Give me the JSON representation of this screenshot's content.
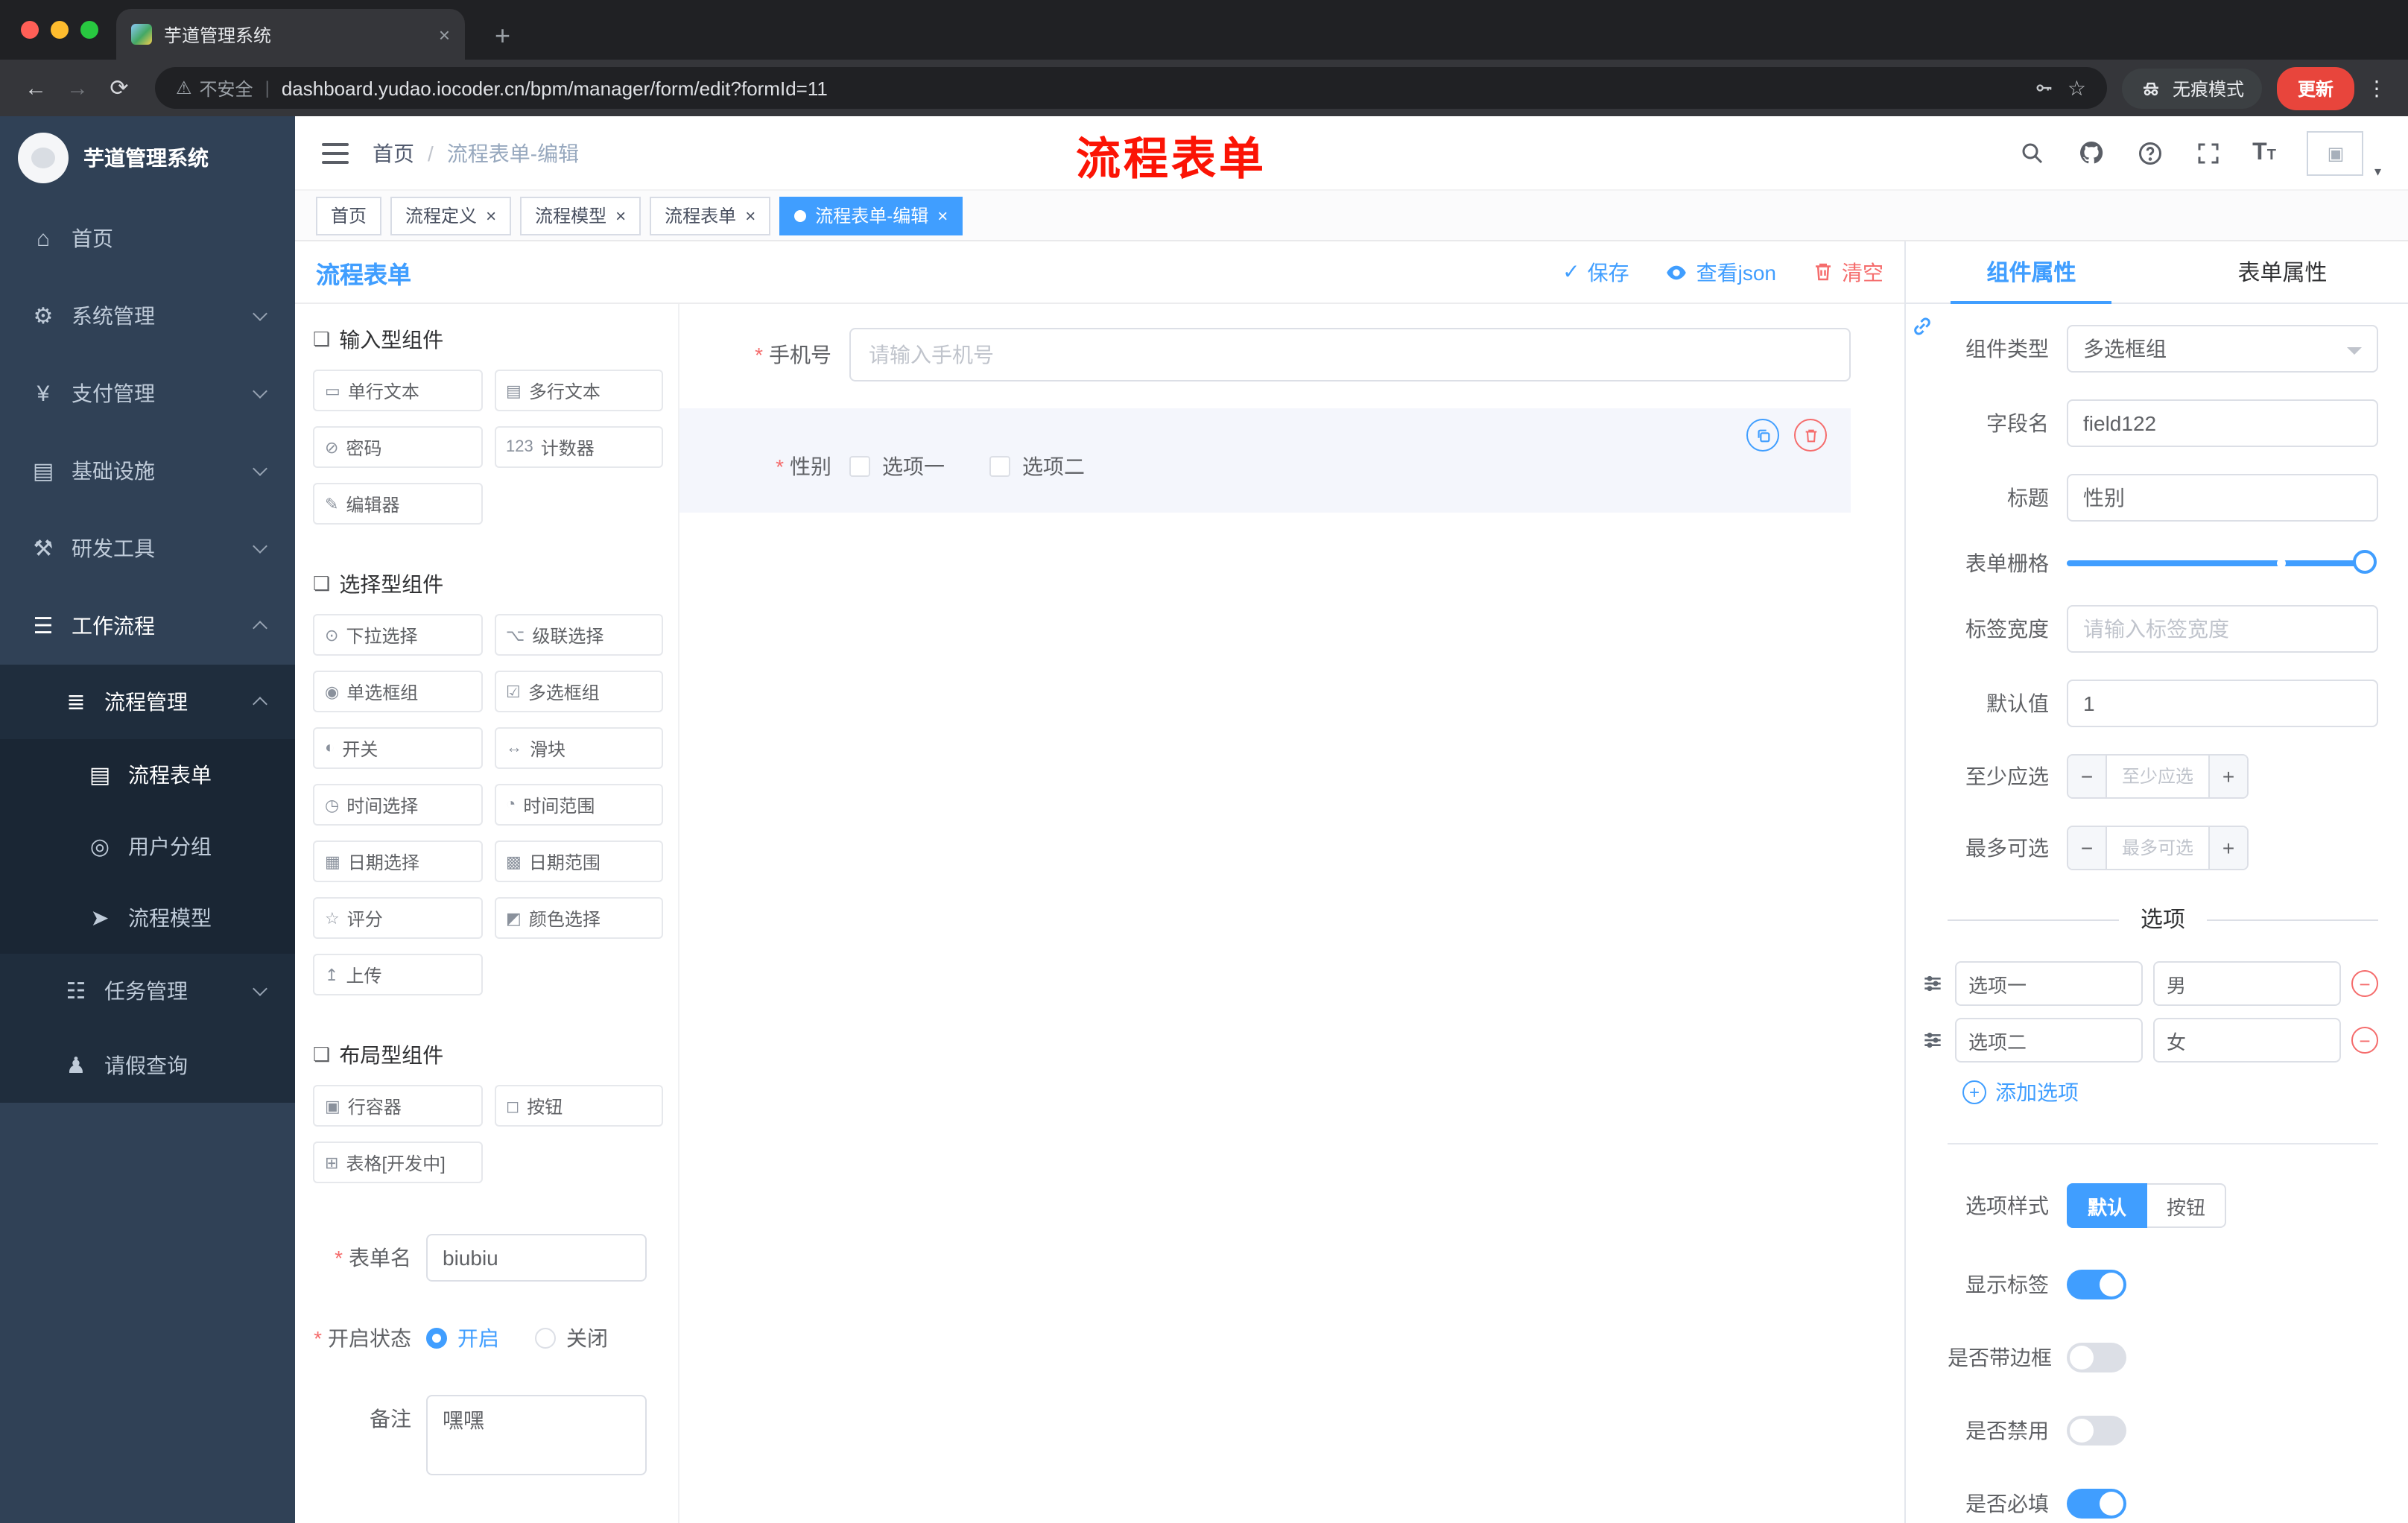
{
  "glyphs": {
    "back": "←",
    "forward": "→",
    "reload": "⟳",
    "plus": "+",
    "close": "×",
    "warning": "⚠",
    "star": "☆",
    "dots": "⋮",
    "caret_down": "▾",
    "pipe": "|",
    "check": "✓",
    "minus": "−",
    "sep": "/",
    "question": "?",
    "font_big": "T",
    "font_small": "T",
    "image_placeholder": "▣",
    "palette_group": "❏"
  },
  "colors": {
    "primary": "#409eff",
    "danger": "#f56c6c",
    "sidebar_bg": "#304156",
    "update_badge": "#e8453c",
    "annotation_red": "#fb1405"
  },
  "browser": {
    "tab_title": "芋道管理系统",
    "address": {
      "warning": "不安全",
      "url": "dashboard.yudao.iocoder.cn/bpm/manager/form/edit?formId=11"
    },
    "incognito_label": "无痕模式",
    "update_label": "更新"
  },
  "annotation": {
    "text": "流程表单"
  },
  "sidebar": {
    "brand": "芋道管理系统",
    "menu": {
      "home": {
        "label": "首页",
        "glyph": "⌂"
      },
      "system": {
        "label": "系统管理",
        "glyph": "⚙"
      },
      "pay": {
        "label": "支付管理",
        "glyph": "¥"
      },
      "infra": {
        "label": "基础设施",
        "glyph": "▤"
      },
      "dev": {
        "label": "研发工具",
        "glyph": "⚒"
      },
      "workflow": {
        "label": "工作流程",
        "glyph": "☰"
      },
      "process_mgmt": {
        "label": "流程管理",
        "glyph": "≣"
      },
      "process_form": {
        "label": "流程表单",
        "glyph": "▤"
      },
      "user_group": {
        "label": "用户分组",
        "glyph": "◎"
      },
      "process_model": {
        "label": "流程模型",
        "glyph": "➤"
      },
      "task_mgmt": {
        "label": "任务管理",
        "glyph": "☷"
      },
      "leave_query": {
        "label": "请假查询",
        "glyph": "♟"
      }
    }
  },
  "header": {
    "breadcrumb": {
      "home": "首页",
      "current": "流程表单-编辑"
    }
  },
  "tags": [
    {
      "label": "首页"
    },
    {
      "label": "流程定义",
      "closable": true
    },
    {
      "label": "流程模型",
      "closable": true
    },
    {
      "label": "流程表单",
      "closable": true
    },
    {
      "label": "流程表单-编辑",
      "closable": true,
      "active": true
    }
  ],
  "designer": {
    "title": "流程表单",
    "actions": {
      "save": "保存",
      "view_json": "查看json",
      "clear": "清空"
    }
  },
  "palette": {
    "groups": [
      {
        "title": "输入型组件",
        "items": [
          {
            "glyph": "▭",
            "label": "单行文本"
          },
          {
            "glyph": "▤",
            "label": "多行文本"
          },
          {
            "glyph": "⊘",
            "label": "密码"
          },
          {
            "glyph": "123",
            "label": "计数器"
          },
          {
            "glyph": "✎",
            "label": "编辑器"
          }
        ]
      },
      {
        "title": "选择型组件",
        "items": [
          {
            "glyph": "⊙",
            "label": "下拉选择"
          },
          {
            "glyph": "⌥",
            "label": "级联选择"
          },
          {
            "glyph": "◉",
            "label": "单选框组"
          },
          {
            "glyph": "☑",
            "label": "多选框组"
          },
          {
            "glyph": "◐",
            "label": "开关"
          },
          {
            "glyph": "↔",
            "label": "滑块"
          },
          {
            "glyph": "◷",
            "label": "时间选择"
          },
          {
            "glyph": "◔",
            "label": "时间范围"
          },
          {
            "glyph": "▦",
            "label": "日期选择"
          },
          {
            "glyph": "▩",
            "label": "日期范围"
          },
          {
            "glyph": "☆",
            "label": "评分"
          },
          {
            "glyph": "◩",
            "label": "颜色选择"
          },
          {
            "glyph": "↥",
            "label": "上传"
          }
        ]
      },
      {
        "title": "布局型组件",
        "items": [
          {
            "glyph": "▣",
            "label": "行容器"
          },
          {
            "glyph": "◻",
            "label": "按钮"
          },
          {
            "glyph": "⊞",
            "label": "表格[开发中]"
          }
        ]
      }
    ]
  },
  "form_settings": {
    "name": {
      "label": "表单名",
      "value": "biubiu"
    },
    "status": {
      "label": "开启状态",
      "on": "开启",
      "off": "关闭"
    },
    "remark": {
      "label": "备注",
      "value": "嘿嘿"
    }
  },
  "canvas": {
    "phone": {
      "label": "手机号",
      "placeholder": "请输入手机号"
    },
    "gender": {
      "label": "性别",
      "options": [
        "选项一",
        "选项二"
      ]
    }
  },
  "props": {
    "tabs": {
      "component": "组件属性",
      "form": "表单属性"
    },
    "rows": {
      "component_type": {
        "label": "组件类型",
        "value": "多选框组"
      },
      "field_name": {
        "label": "字段名",
        "value": "field122"
      },
      "title": {
        "label": "标题",
        "value": "性别"
      },
      "grid": {
        "label": "表单栅格"
      },
      "label_width": {
        "label": "标签宽度",
        "placeholder": "请输入标签宽度"
      },
      "default": {
        "label": "默认值",
        "value": "1"
      },
      "min": {
        "label": "至少应选",
        "placeholder": "至少应选"
      },
      "max": {
        "label": "最多可选",
        "placeholder": "最多可选"
      }
    },
    "options_title": "选项",
    "options": [
      {
        "name": "选项一",
        "value": "男"
      },
      {
        "name": "选项二",
        "value": "女"
      }
    ],
    "add_option": "添加选项",
    "style": {
      "label": "选项样式",
      "default": "默认",
      "button": "按钮"
    },
    "switches": [
      {
        "label": "显示标签",
        "on": true
      },
      {
        "label": "是否带边框",
        "on": false
      },
      {
        "label": "是否禁用",
        "on": false
      },
      {
        "label": "是否必填",
        "on": true
      }
    ]
  }
}
